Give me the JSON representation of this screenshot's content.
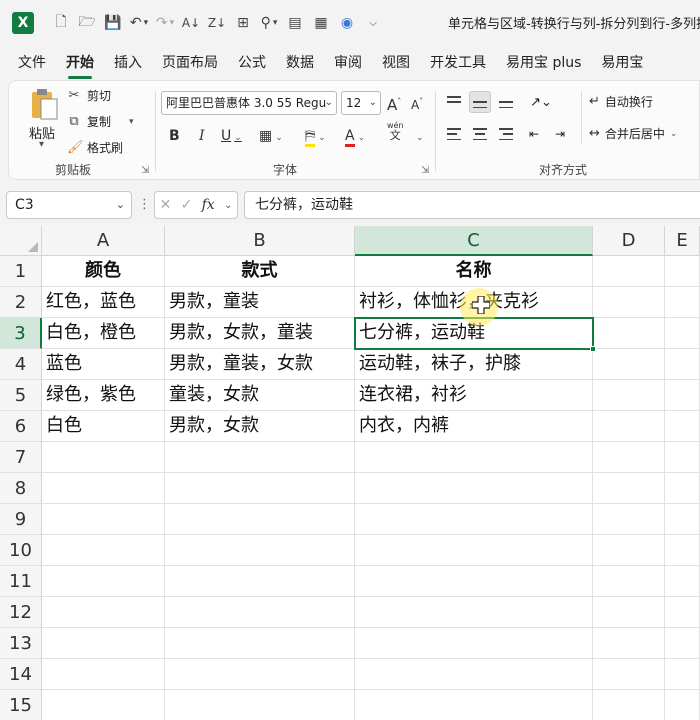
{
  "titlebar": {
    "app_icon_letter": "X",
    "doc_title": "单元格与区域-转换行与列-拆分列到行-多列拆"
  },
  "ribbon_tabs": [
    "文件",
    "开始",
    "插入",
    "页面布局",
    "公式",
    "数据",
    "审阅",
    "视图",
    "开发工具",
    "易用宝 plus",
    "易用宝"
  ],
  "clipboard": {
    "paste": "粘贴",
    "cut": "剪切",
    "copy": "复制",
    "format_painter": "格式刷",
    "group_label": "剪贴板"
  },
  "font": {
    "name": "阿里巴巴普惠体 3.0 55 Regu",
    "size": "12",
    "grow": "A",
    "shrink": "A",
    "bold": "B",
    "italic": "I",
    "underline": "U",
    "font_color": "A",
    "phonetic_top": "wén",
    "phonetic_bottom": "文",
    "group_label": "字体"
  },
  "alignment": {
    "wrap_text": "自动换行",
    "merge_center": "合并后居中",
    "group_label": "对齐方式"
  },
  "formula_bar": {
    "name_box": "C3",
    "fx": "fx",
    "formula": "七分裤，运动鞋"
  },
  "grid": {
    "columns": [
      "A",
      "B",
      "C",
      "D",
      "E"
    ],
    "rows": [
      "1",
      "2",
      "3",
      "4",
      "5",
      "6",
      "7",
      "8",
      "9",
      "10",
      "11",
      "12",
      "13",
      "14",
      "15"
    ],
    "cells": [
      [
        "颜色",
        "款式",
        "名称"
      ],
      [
        "红色，蓝色",
        "男款，童装",
        "衬衫，体恤衫，夹克衫"
      ],
      [
        "白色，橙色",
        "男款，女款，童装",
        "七分裤，运动鞋"
      ],
      [
        "蓝色",
        "男款，童装，女款",
        "运动鞋，袜子，护膝"
      ],
      [
        "绿色，紫色",
        "童装，女款",
        "连衣裙，衬衫"
      ],
      [
        "白色",
        "男款，女款",
        "内衣，内裤"
      ]
    ],
    "selected_cell": "C3"
  },
  "colors": {
    "accent": "#107c41",
    "selection_header": "#d2e6da",
    "cursor_highlight": "#ffec5a"
  }
}
